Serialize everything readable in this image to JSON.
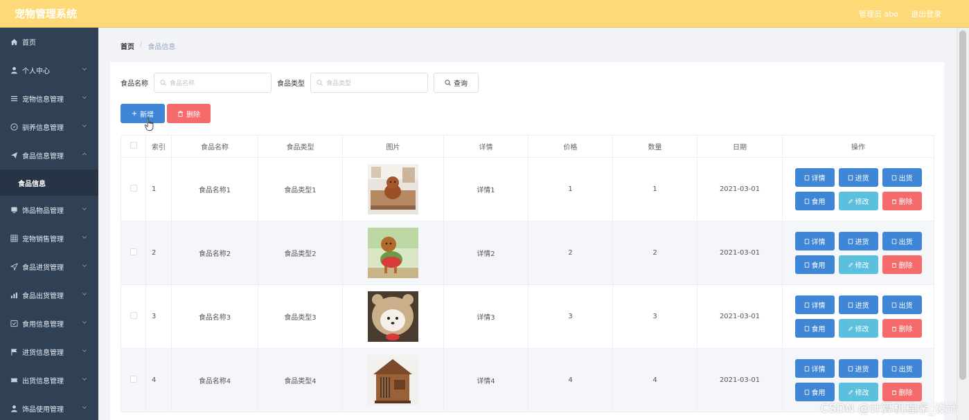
{
  "header": {
    "title": "宠物管理系统",
    "user": "管理员 abo",
    "logout": "退出登录"
  },
  "sidebar": {
    "items": [
      {
        "label": "首页",
        "icon": "home-icon"
      },
      {
        "label": "个人中心",
        "icon": "user-icon"
      },
      {
        "label": "宠物信息管理",
        "icon": "list-icon"
      },
      {
        "label": "驯养信息管理",
        "icon": "compass-icon"
      },
      {
        "label": "食品信息管理",
        "icon": "send-icon",
        "expanded": true
      },
      {
        "label": "饰品物品管理",
        "icon": "monitor-icon"
      },
      {
        "label": "宠物销售管理",
        "icon": "grid-icon"
      },
      {
        "label": "食品进货管理",
        "icon": "navigation-icon"
      },
      {
        "label": "食品出货管理",
        "icon": "chart-icon"
      },
      {
        "label": "食用信息管理",
        "icon": "check-square-icon"
      },
      {
        "label": "进货信息管理",
        "icon": "flag-icon"
      },
      {
        "label": "出货信息管理",
        "icon": "ticket-icon"
      },
      {
        "label": "饰品使用管理",
        "icon": "user-icon"
      }
    ],
    "sub_item": "食品信息"
  },
  "breadcrumb": {
    "home": "首页",
    "separator": "/",
    "current": "食品信息"
  },
  "search": {
    "name_label": "食品名称",
    "name_placeholder": "食品名称",
    "type_label": "食品类型",
    "type_placeholder": "食品类型",
    "query_label": "查询"
  },
  "actions": {
    "add_label": "新增",
    "delete_label": "删除"
  },
  "table": {
    "columns": [
      "",
      "索引",
      "食品名称",
      "食品类型",
      "图片",
      "详情",
      "价格",
      "数量",
      "日期",
      "操作"
    ],
    "rows": [
      {
        "index": "1",
        "name": "食品名称1",
        "type": "食品类型1",
        "detail": "详情1",
        "price": "1",
        "qty": "1",
        "date": "2021-03-01"
      },
      {
        "index": "2",
        "name": "食品名称2",
        "type": "食品类型2",
        "detail": "详情2",
        "price": "2",
        "qty": "2",
        "date": "2021-03-01"
      },
      {
        "index": "3",
        "name": "食品名称3",
        "type": "食品类型3",
        "detail": "详情3",
        "price": "3",
        "qty": "3",
        "date": "2021-03-01"
      },
      {
        "index": "4",
        "name": "食品名称4",
        "type": "食品类型4",
        "detail": "详情4",
        "price": "4",
        "qty": "4",
        "date": "2021-03-01"
      }
    ],
    "op_labels": {
      "detail": "详情",
      "stock_in": "进货",
      "stock_out": "出货",
      "consume": "食用",
      "edit": "修改",
      "delete": "删除"
    }
  },
  "watermark": "CSDN @计算机程序_设计",
  "colors": {
    "header_bg": "#fed978",
    "sidebar_bg": "#304156",
    "primary": "#3f87d6",
    "info": "#5bc0de",
    "danger": "#f56a6a"
  }
}
